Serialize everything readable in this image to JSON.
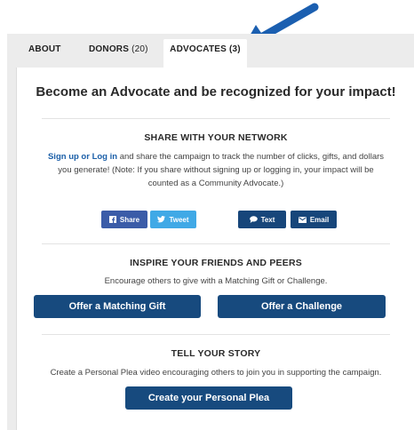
{
  "tabs": [
    {
      "label": "ABOUT",
      "count": ""
    },
    {
      "label": "DONORS",
      "count": "(20)"
    },
    {
      "label": "ADVOCATES",
      "count": "(3)"
    }
  ],
  "headline": "Become an Advocate and be recognized for your impact!",
  "share_section": {
    "title": "SHARE WITH YOUR NETWORK",
    "link_text": "Sign up or Log in",
    "text_line1": " and share the campaign to track the number of clicks, gifts, and dollars",
    "text_line2": "you generate! (Note: If you share without signing up or logging in, your impact will be",
    "text_line3": "counted as a Community Advocate.)",
    "buttons": {
      "share": "Share",
      "tweet": "Tweet",
      "text": "Text",
      "email": "Email"
    }
  },
  "inspire_section": {
    "title": "INSPIRE YOUR FRIENDS AND PEERS",
    "text": "Encourage others to give with a Matching Gift or Challenge.",
    "matching_button": "Offer a Matching Gift",
    "challenge_button": "Offer a Challenge"
  },
  "story_section": {
    "title": "TELL YOUR STORY",
    "text": "Create a Personal Plea video encouraging others to join you in supporting the campaign.",
    "plea_button": "Create your Personal Plea"
  },
  "colors": {
    "arrow": "#1b5fb0",
    "primary_button": "#174a7e",
    "facebook": "#3b5ca8",
    "twitter": "#40a9e6",
    "link": "#1b5fa8"
  }
}
